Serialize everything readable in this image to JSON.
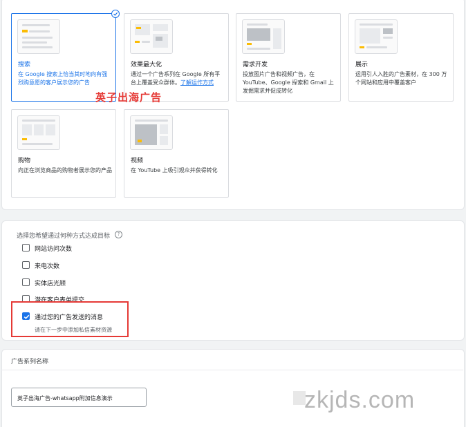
{
  "campaign_types": [
    {
      "title": "搜索",
      "desc": "在 Google 搜索上恰当其时地向有强烈购意愿的客户展示您的广告",
      "selected": true
    },
    {
      "title": "效果最大化",
      "desc": "通过一个广告系列在 Google 所有平台上覆盖受众群体。",
      "link": "了解运作方式",
      "selected": false
    },
    {
      "title": "需求开发",
      "desc": "投放图片广告和视频广告，在 YouTube、Google 探索和 Gmail 上发掘需求并促成转化",
      "selected": false
    },
    {
      "title": "展示",
      "desc": "运用引人入胜的广告素材，在 300 万个网站和应用中覆盖客户",
      "selected": false
    },
    {
      "title": "购物",
      "desc": "向正在浏览商品的购物者展示您的产品",
      "selected": false
    },
    {
      "title": "视频",
      "desc": "在 YouTube 上吸引观众并获得转化",
      "selected": false
    }
  ],
  "overlay_text": "英子出海广告",
  "goals": {
    "heading": "选择您希望通过何种方式达成目标",
    "help_icon": "?",
    "options": [
      {
        "label": "网站访问次数",
        "checked": false
      },
      {
        "label": "来电次数",
        "checked": false
      },
      {
        "label": "实体店光顾",
        "checked": false
      },
      {
        "label": "潜在客户表单提交",
        "checked": false
      },
      {
        "label": "通过您的广告发送的消息",
        "checked": true
      }
    ],
    "selected_hint": "请在下一步中添加私信素材资源"
  },
  "campaign_name": {
    "title": "广告系列名称",
    "value": "英子出海广告-whatsapp附加信息演示"
  },
  "watermark": "zkjds.com",
  "colors": {
    "accent": "#1a73e8",
    "highlight": "#e53935",
    "card_border": "#dadce0"
  }
}
